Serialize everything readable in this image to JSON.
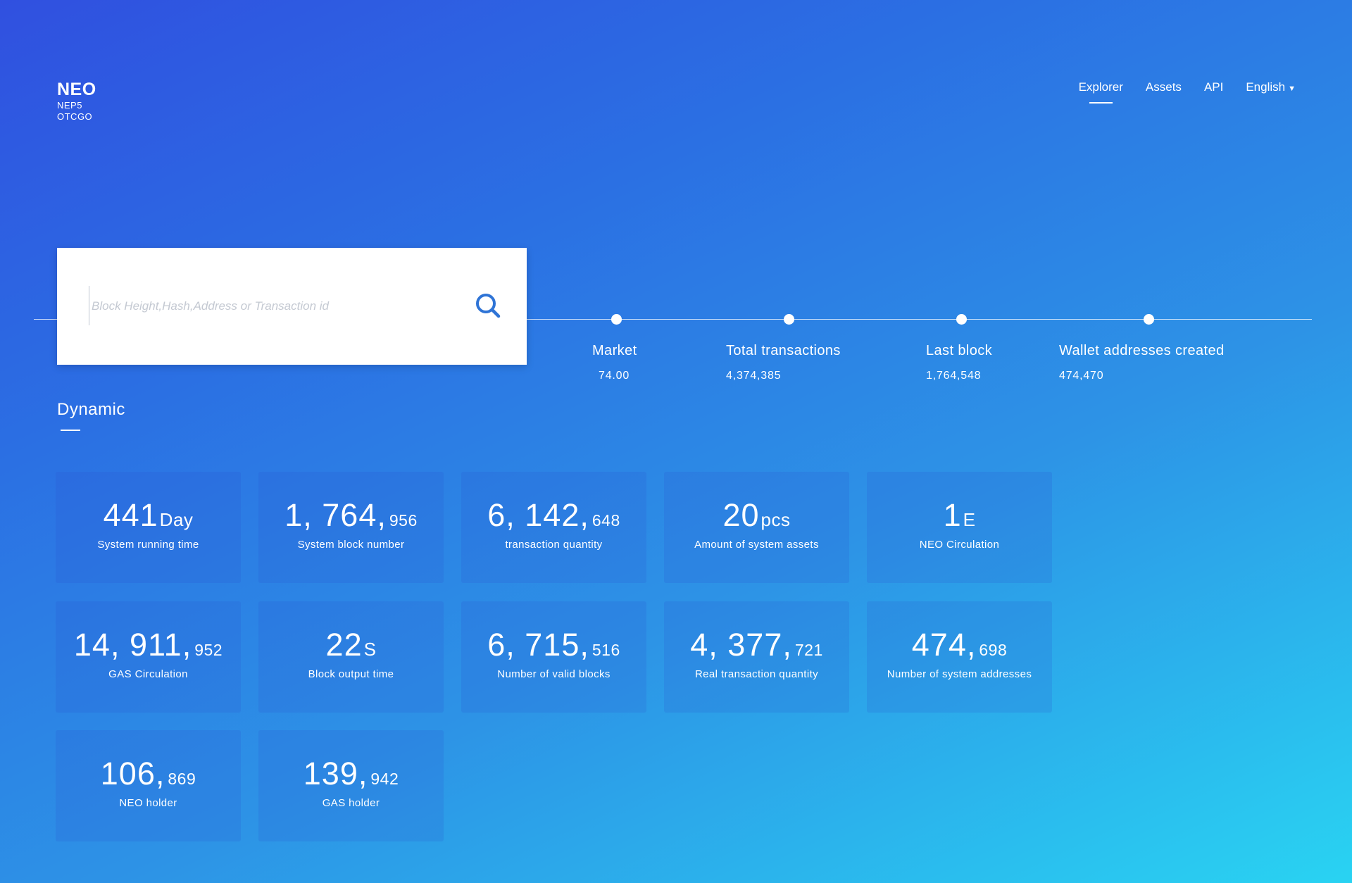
{
  "logo": {
    "brand": "NEO",
    "sub1": "NEP5",
    "sub2": "OTCGO"
  },
  "nav": {
    "explorer": "Explorer",
    "assets": "Assets",
    "api": "API",
    "language": "English"
  },
  "search": {
    "placeholder": "Block Height,Hash,Address or Transaction id",
    "icon": "search-icon"
  },
  "stats": [
    {
      "label": "Market",
      "value": "74.00"
    },
    {
      "label": "Total transactions",
      "value": "4,374,385"
    },
    {
      "label": "Last block",
      "value": "1,764,548"
    },
    {
      "label": "Wallet addresses created",
      "value": "474,470"
    }
  ],
  "section": {
    "title": "Dynamic"
  },
  "cards": [
    {
      "main": "441",
      "suffix": "Day",
      "label": "System running time"
    },
    {
      "main": "1, 764,",
      "suffix": "956",
      "label": "System block number"
    },
    {
      "main": "6, 142,",
      "suffix": "648",
      "label": "transaction quantity"
    },
    {
      "main": "20",
      "suffix": "pcs",
      "label": "Amount of system assets"
    },
    {
      "main": "1",
      "suffix": "E",
      "label": "NEO  Circulation"
    },
    {
      "main": "14, 911,",
      "suffix": "952",
      "label": "GAS  Circulation"
    },
    {
      "main": "22",
      "suffix": "S",
      "label": "Block output time"
    },
    {
      "main": "6, 715,",
      "suffix": "516",
      "label": "Number of valid blocks"
    },
    {
      "main": "4, 377,",
      "suffix": "721",
      "label": "Real transaction quantity"
    },
    {
      "main": "474,",
      "suffix": "698",
      "label": "Number of system addresses"
    },
    {
      "main": "106,",
      "suffix": "869",
      "label": "NEO  holder"
    },
    {
      "main": "139,",
      "suffix": "942",
      "label": "GAS  holder"
    }
  ],
  "colors": {
    "gradient_start": "#3050e0",
    "gradient_end": "#29d3f2",
    "search_icon": "#2f74d6"
  }
}
